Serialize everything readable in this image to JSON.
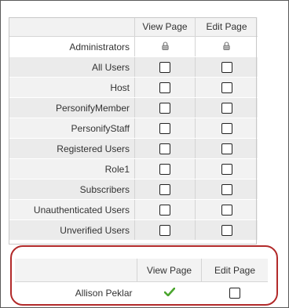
{
  "roles_table": {
    "columns": [
      "View Page",
      "Edit Page"
    ],
    "rows": [
      {
        "name": "Administrators",
        "view": "locked",
        "edit": "locked"
      },
      {
        "name": "All Users",
        "view": "unchecked",
        "edit": "unchecked"
      },
      {
        "name": "Host",
        "view": "unchecked",
        "edit": "unchecked"
      },
      {
        "name": "PersonifyMember",
        "view": "unchecked",
        "edit": "unchecked"
      },
      {
        "name": "PersonifyStaff",
        "view": "unchecked",
        "edit": "unchecked"
      },
      {
        "name": "Registered Users",
        "view": "unchecked",
        "edit": "unchecked"
      },
      {
        "name": "Role1",
        "view": "unchecked",
        "edit": "unchecked"
      },
      {
        "name": "Subscribers",
        "view": "unchecked",
        "edit": "unchecked"
      },
      {
        "name": "Unauthenticated Users",
        "view": "unchecked",
        "edit": "unchecked"
      },
      {
        "name": "Unverified Users",
        "view": "unchecked",
        "edit": "unchecked"
      }
    ]
  },
  "users_table": {
    "columns": [
      "View Page",
      "Edit Page"
    ],
    "rows": [
      {
        "name": "Allison Peklar",
        "view": "granted",
        "edit": "unchecked"
      }
    ]
  },
  "colors": {
    "highlight_border": "#b22a2a",
    "granted_check": "#4aa52e",
    "header_bg": "#f2f2f2"
  }
}
